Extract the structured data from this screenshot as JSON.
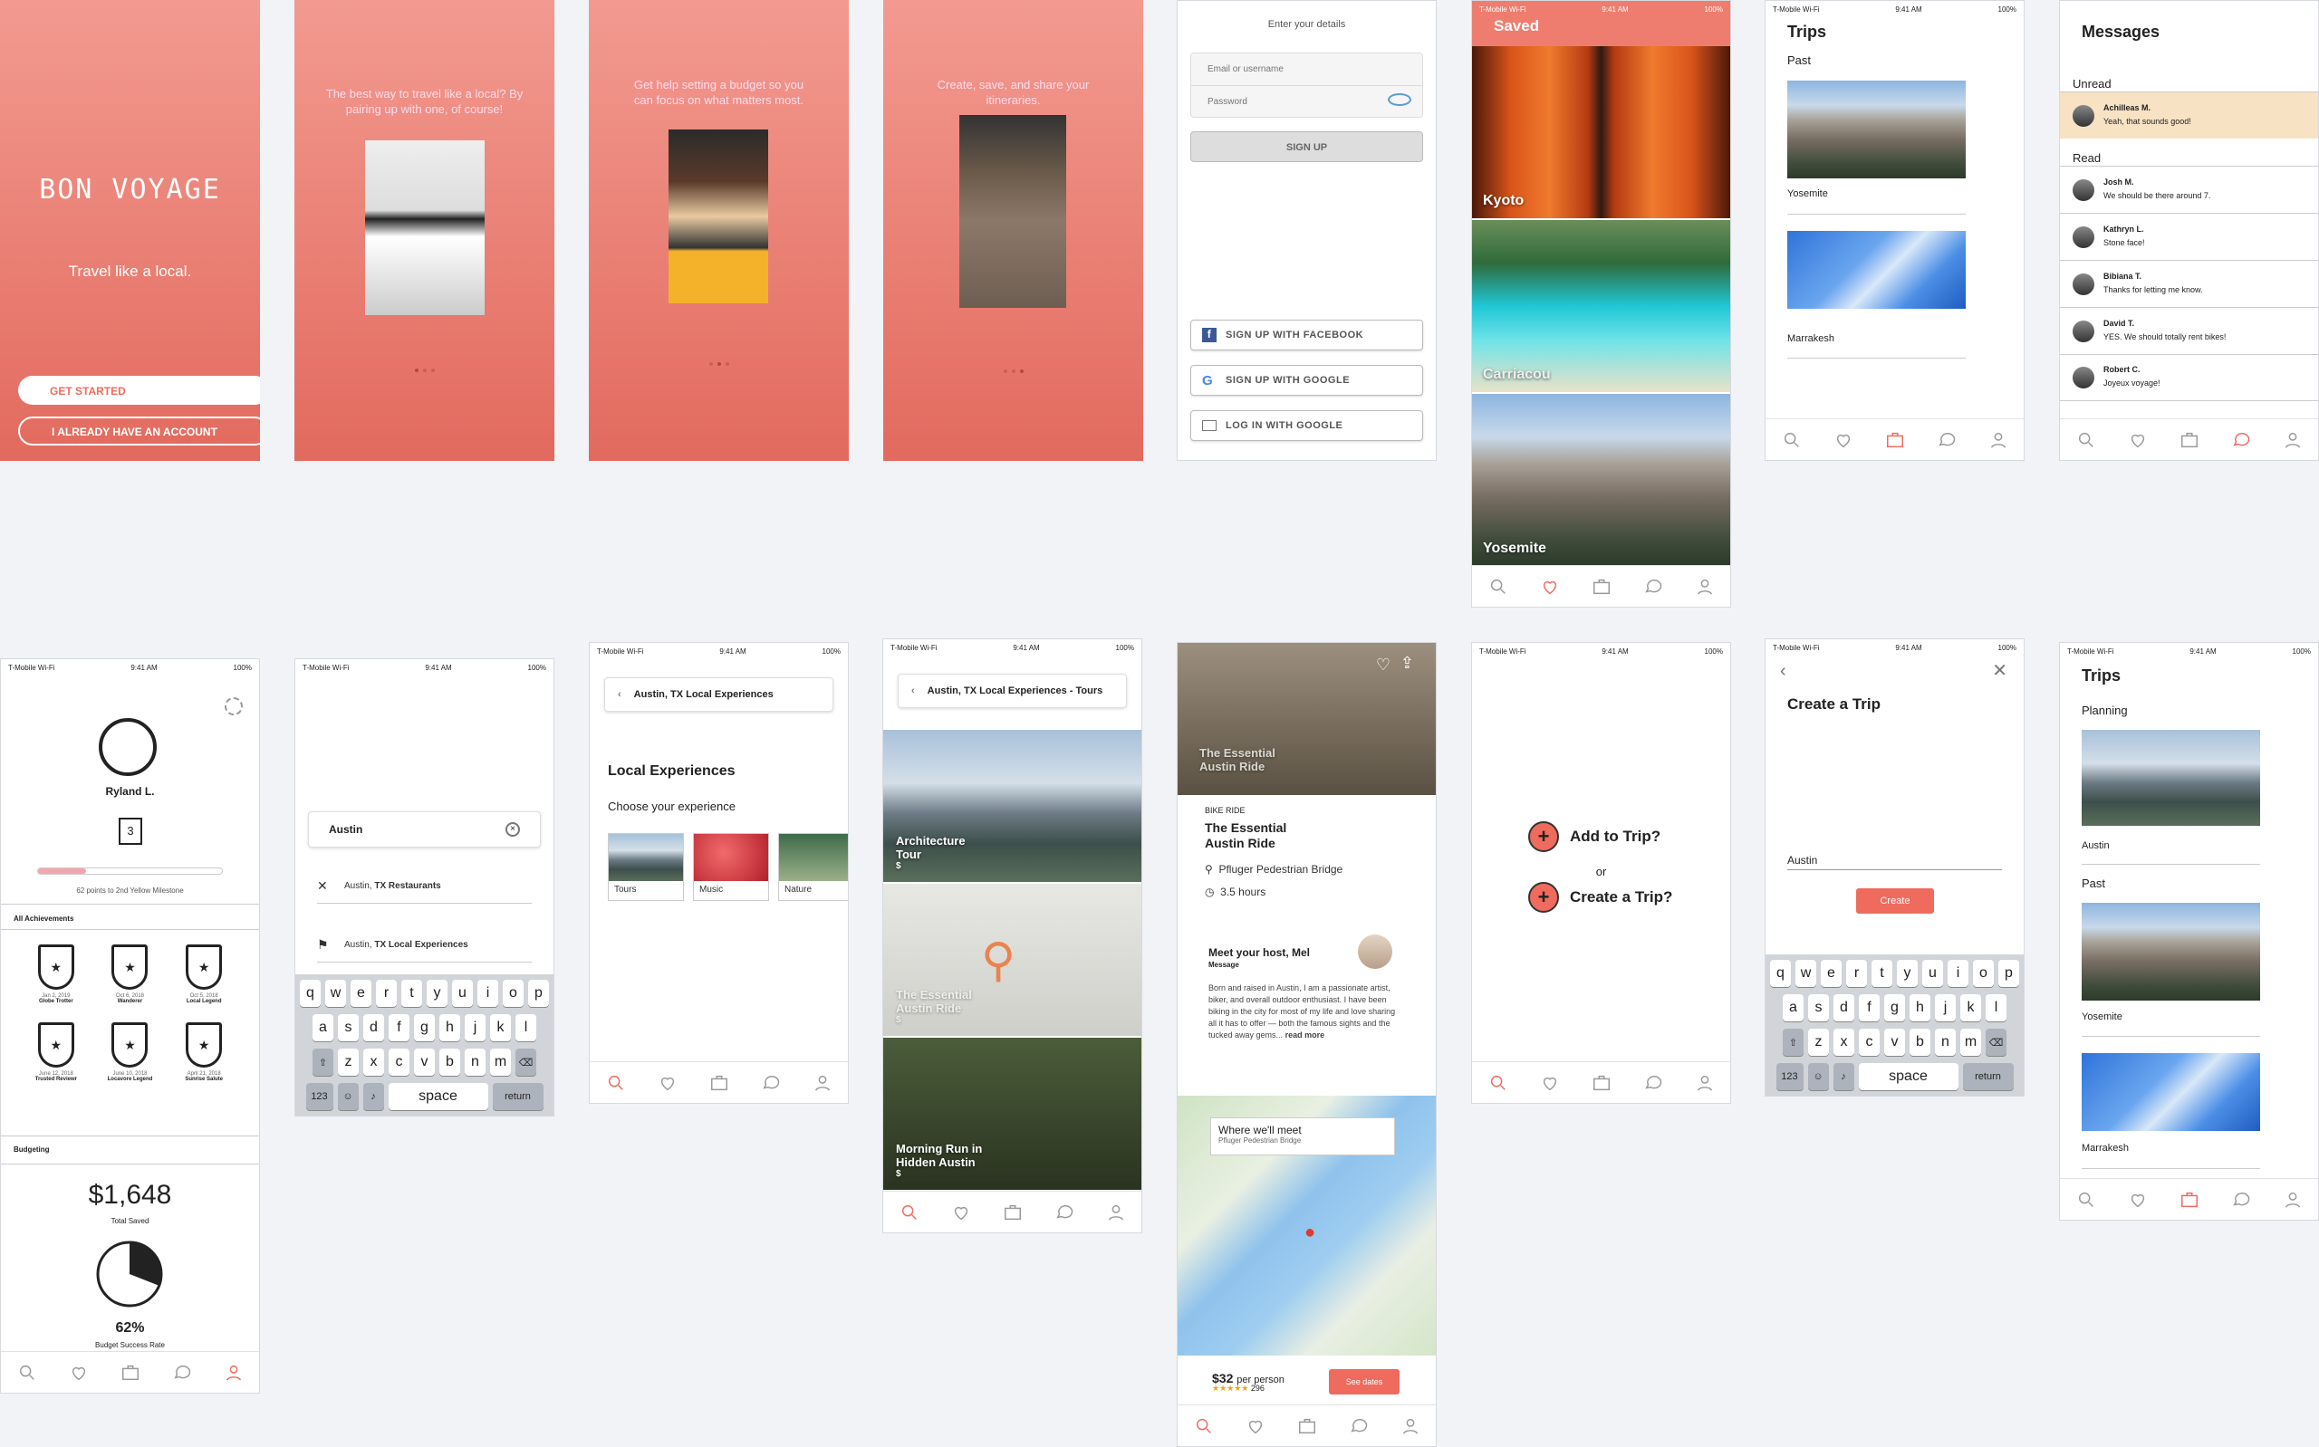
{
  "statusbar": {
    "carrier": "T-Mobile Wi-Fi",
    "time": "9:41 AM",
    "battery": "100%"
  },
  "welcome": {
    "logo": "BON VOYAGE",
    "tagline": "Travel like a local.",
    "get_started": "GET STARTED",
    "have_account": "I ALREADY HAVE AN ACCOUNT"
  },
  "onboard1": {
    "text": "The best way to travel like a local? By pairing up with one, of course!"
  },
  "onboard2": {
    "text": "Get help setting a budget so you can focus on what matters most."
  },
  "onboard3": {
    "text": "Create, save, and share your itineraries."
  },
  "signup": {
    "title": "Enter your details",
    "email_ph": "Email or username",
    "password_ph": "Password",
    "signup": "SIGN UP",
    "facebook": "SIGN UP WITH FACEBOOK",
    "google": "SIGN UP WITH GOOGLE",
    "login_google": "LOG IN WITH GOOGLE"
  },
  "saved": {
    "title": "Saved",
    "items": [
      "Kyoto",
      "Carriacou",
      "Yosemite"
    ]
  },
  "trips1": {
    "title": "Trips",
    "section": "Past",
    "items": [
      "Yosemite",
      "Marrakesh"
    ]
  },
  "messages": {
    "title": "Messages",
    "unread": "Unread",
    "read": "Read",
    "unread_items": [
      {
        "name": "Achilleas M.",
        "text": "Yeah, that sounds good!"
      }
    ],
    "read_items": [
      {
        "name": "Josh M.",
        "text": "We should be there around 7."
      },
      {
        "name": "Kathryn L.",
        "text": "Stone face!"
      },
      {
        "name": "Bibiana T.",
        "text": "Thanks for letting me know."
      },
      {
        "name": "David T.",
        "text": "YES. We should totally rent bikes!"
      },
      {
        "name": "Robert C.",
        "text": "Joyeux voyage!"
      }
    ]
  },
  "profile": {
    "name": "Ryland L.",
    "level": "3",
    "milestone": "62 points to 2nd Yellow Milestone",
    "achievements_title": "All Achievements",
    "achievements": [
      {
        "date": "Jan 2, 2019",
        "name": "Globe Trotter"
      },
      {
        "date": "Oct 6, 2018",
        "name": "Wanderer"
      },
      {
        "date": "Oct 5, 2018",
        "name": "Local Legend"
      },
      {
        "date": "June 12, 2018",
        "name": "Trusted Reviewr"
      },
      {
        "date": "June 10, 2018",
        "name": "Locavore Legend"
      },
      {
        "date": "April 21, 2018",
        "name": "Sunrise Salute"
      }
    ],
    "budgeting": "Budgeting",
    "total": "$1,648",
    "total_label": "Total Saved",
    "rate": "62%",
    "rate_label": "Budget Success Rate"
  },
  "search": {
    "query": "Austin",
    "results": [
      {
        "city": "Austin,",
        "rest": "TX Restaurants"
      },
      {
        "city": "Austin,",
        "rest": "TX Local Experiences"
      }
    ]
  },
  "keyboard": {
    "row1": [
      "q",
      "w",
      "e",
      "r",
      "t",
      "y",
      "u",
      "i",
      "o",
      "p"
    ],
    "row2": [
      "a",
      "s",
      "d",
      "f",
      "g",
      "h",
      "j",
      "k",
      "l"
    ],
    "row3": [
      "z",
      "x",
      "c",
      "v",
      "b",
      "n",
      "m"
    ],
    "num": "123",
    "space": "space",
    "return": "return"
  },
  "local": {
    "crumb": "Austin, TX Local Experiences",
    "title": "Local Experiences",
    "subtitle": "Choose your experience",
    "cats": [
      "Tours",
      "Music",
      "Nature"
    ]
  },
  "tours": {
    "crumb": "Austin, TX Local Experiences - Tours",
    "items": [
      {
        "name": "Architecture Tour",
        "price": "$"
      },
      {
        "name": "The Essential Austin Ride",
        "price": "$"
      },
      {
        "name": "Morning Run in Hidden Austin",
        "price": "$"
      }
    ]
  },
  "detail": {
    "hero": "The Essential Austin Ride",
    "category": "BIKE RIDE",
    "title": "The Essential Austin Ride",
    "location": "Pfluger Pedestrian Bridge",
    "duration": "3.5 hours",
    "host": "Meet your host, Mel",
    "message": "Message",
    "bio": "Born and raised in Austin, I am a passionate artist, biker, and overall outdoor enthusiast. I have been biking in the city for most of my life and love sharing all it has to offer — both the famous sights and the tucked away gems...",
    "read_more": "read more",
    "meet": "Where we'll meet",
    "meet_place": "Pfluger Pedestrian Bridge",
    "price": "$32",
    "per": "per person",
    "reviews": "296",
    "cta": "See dates"
  },
  "addtrip": {
    "add": "Add to Trip?",
    "or": "or",
    "create": "Create a Trip?"
  },
  "create": {
    "title": "Create a Trip",
    "value": "Austin",
    "button": "Create"
  },
  "trips2": {
    "title": "Trips",
    "planning": "Planning",
    "past": "Past",
    "items": [
      "Austin",
      "Yosemite",
      "Marrakesh"
    ]
  },
  "colors": {
    "accent": "#ee6b5e"
  }
}
